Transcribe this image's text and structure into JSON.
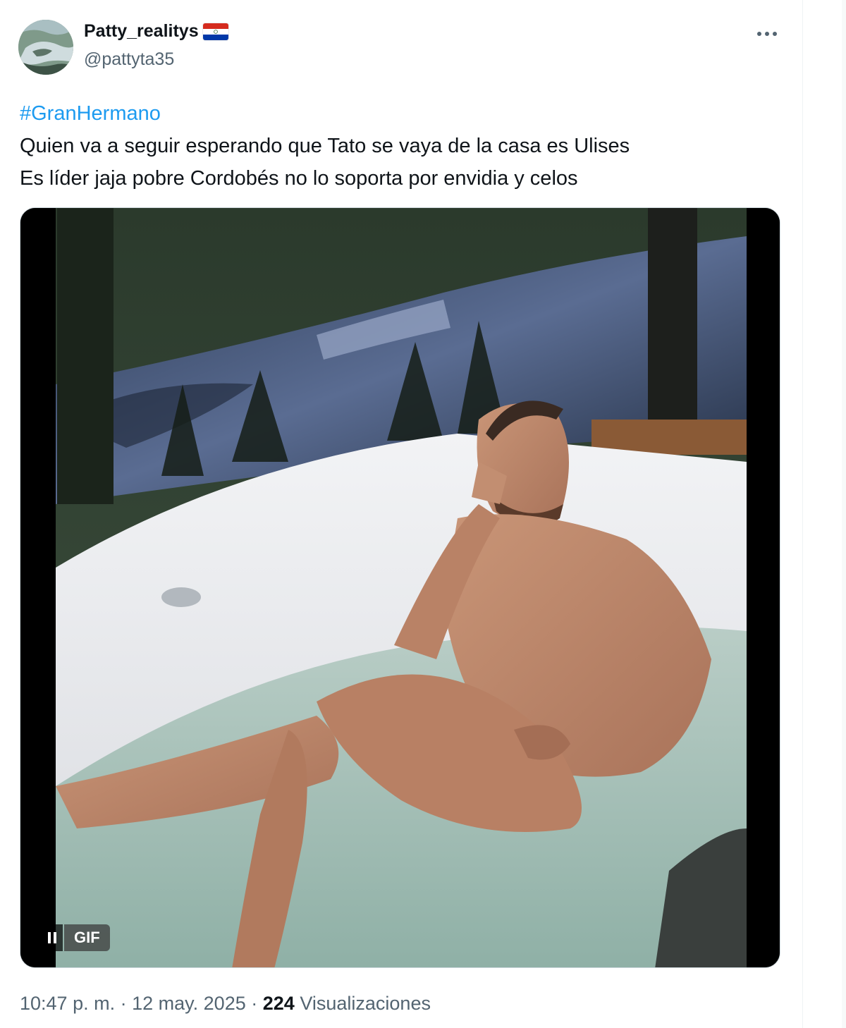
{
  "user": {
    "name": "Patty_realitys",
    "handle": "@pattyta35"
  },
  "tweet": {
    "hashtag": "#GranHermano",
    "lines": [
      "Quien va a seguir esperando que Tato se vaya de la casa es Ulises",
      "Es líder jaja pobre Cordobés no lo soporta por envidia y celos"
    ]
  },
  "media": {
    "badge": "GIF",
    "pause_icon": "pause-icon"
  },
  "meta": {
    "time": "10:47 p. m.",
    "separator": "·",
    "date": "12 may. 2025",
    "views_count": "224",
    "views_label": "Visualizaciones"
  },
  "colors": {
    "accent": "#1d9bf0",
    "secondary_text": "#536471",
    "primary_text": "#0f1419"
  }
}
